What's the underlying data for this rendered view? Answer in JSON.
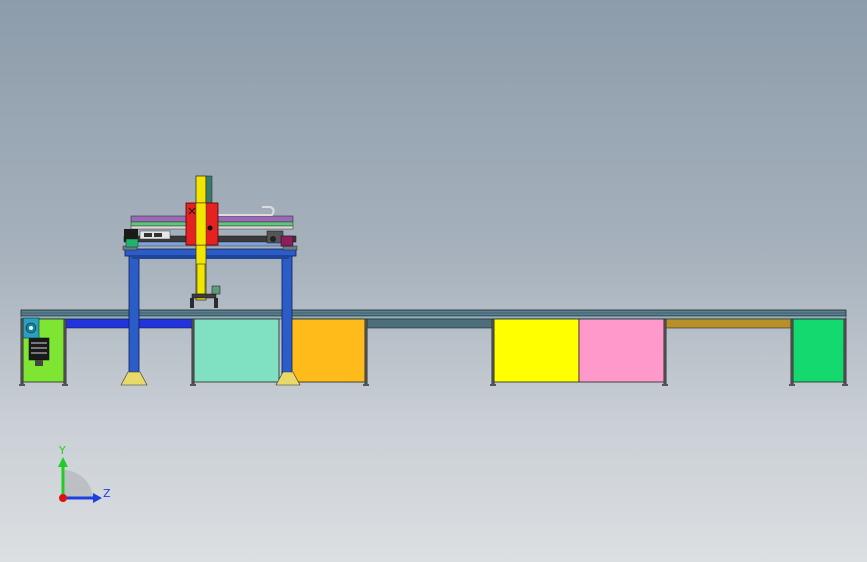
{
  "axes": {
    "y_label": "Y",
    "z_label": "Z",
    "y_color": "#22cc22",
    "z_color": "#1f3fdd",
    "origin_color": "#dd1111"
  },
  "model": {
    "rail_color": "#5a7f8d",
    "frame_color": "#2b5cc8",
    "column_color": "#f2e600",
    "carriage_color": "#e52222",
    "conveyor_segments": [
      {
        "name": "segment-1",
        "color": "#2233dd"
      },
      {
        "name": "segment-2",
        "color": "#2233dd"
      },
      {
        "name": "segment-3",
        "color": "#4d6e7a"
      },
      {
        "name": "segment-4",
        "color": "#b8902a"
      }
    ],
    "stations": [
      {
        "name": "station-green-end",
        "color": "#7ee632"
      },
      {
        "name": "station-mint",
        "color": "#7fe1c2"
      },
      {
        "name": "station-orange",
        "color": "#ffbb1a"
      },
      {
        "name": "station-yellow",
        "color": "#ffff00"
      },
      {
        "name": "station-pink",
        "color": "#ff99cc"
      },
      {
        "name": "station-green",
        "color": "#14d96e"
      }
    ]
  }
}
